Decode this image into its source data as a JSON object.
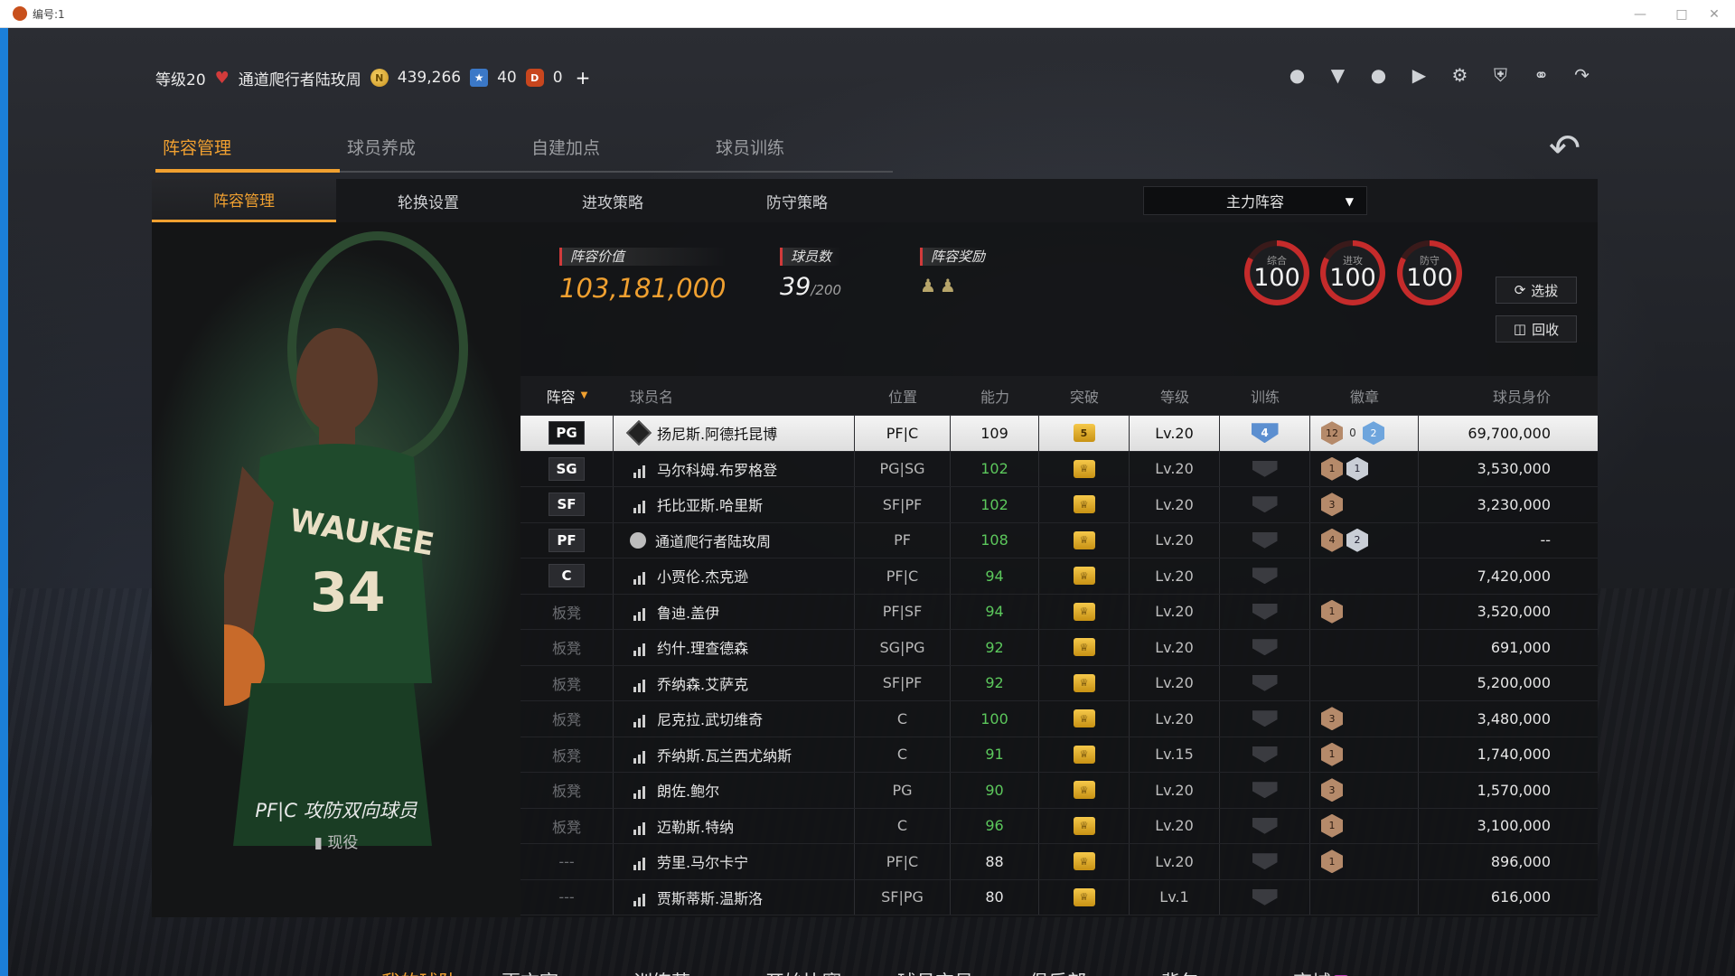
{
  "window": {
    "title": "编号:1"
  },
  "status": {
    "level": "等级20",
    "player_name": "通道爬行者陆玫周",
    "coins": "439,266",
    "stars": "40",
    "gems": "0"
  },
  "main_tabs": [
    "阵容管理",
    "球员养成",
    "自建加点",
    "球员训练"
  ],
  "sub_tabs": [
    "阵容管理",
    "轮换设置",
    "进攻策略",
    "防守策略"
  ],
  "lineup_dropdown": "主力阵容",
  "stats": {
    "value_label": "阵容价值",
    "value": "103,181,000",
    "count_label": "球员数",
    "count": "39",
    "count_max": "/200",
    "reward_label": "阵容奖励"
  },
  "gauges": [
    {
      "label": "综合",
      "value": "100"
    },
    {
      "label": "进攻",
      "value": "100"
    },
    {
      "label": "防守",
      "value": "100"
    }
  ],
  "buttons": {
    "draft": "选拔",
    "recycle": "回收"
  },
  "player_card": {
    "role": "PF|C 攻防双向球员",
    "status": "现役"
  },
  "table": {
    "headers": {
      "slot": "阵容",
      "name": "球员名",
      "pos": "位置",
      "ovr": "能力",
      "breakthrough": "突破",
      "level": "等级",
      "training": "训练",
      "badges": "徽章",
      "value": "球员身价"
    },
    "rows": [
      {
        "slot": "PG",
        "name": "扬尼斯.阿德托昆博",
        "pos": "PF|C",
        "ovr": "109",
        "brk": "5",
        "lvl": "Lv.20",
        "trn": "4",
        "badges": [
          "12",
          "0",
          "2"
        ],
        "val": "69,700,000"
      },
      {
        "slot": "SG",
        "name": "马尔科姆.布罗格登",
        "pos": "PG|SG",
        "ovr": "102",
        "brk": "",
        "lvl": "Lv.20",
        "trn": "",
        "badges": [
          "1",
          "1"
        ],
        "val": "3,530,000"
      },
      {
        "slot": "SF",
        "name": "托比亚斯.哈里斯",
        "pos": "SF|PF",
        "ovr": "102",
        "brk": "",
        "lvl": "Lv.20",
        "trn": "",
        "badges": [
          "3"
        ],
        "val": "3,230,000"
      },
      {
        "slot": "PF",
        "name": "通道爬行者陆玫周",
        "pos": "PF",
        "ovr": "108",
        "brk": "",
        "lvl": "Lv.20",
        "trn": "",
        "badges": [
          "4",
          "2"
        ],
        "val": "--"
      },
      {
        "slot": "C",
        "name": "小贾伦.杰克逊",
        "pos": "PF|C",
        "ovr": "94",
        "brk": "",
        "lvl": "Lv.20",
        "trn": "",
        "badges": [],
        "val": "7,420,000"
      },
      {
        "slot": "板凳",
        "name": "鲁迪.盖伊",
        "pos": "PF|SF",
        "ovr": "94",
        "brk": "",
        "lvl": "Lv.20",
        "trn": "",
        "badges": [
          "1"
        ],
        "val": "3,520,000"
      },
      {
        "slot": "板凳",
        "name": "约什.理查德森",
        "pos": "SG|PG",
        "ovr": "92",
        "brk": "",
        "lvl": "Lv.20",
        "trn": "",
        "badges": [],
        "val": "691,000"
      },
      {
        "slot": "板凳",
        "name": "乔纳森.艾萨克",
        "pos": "SF|PF",
        "ovr": "92",
        "brk": "",
        "lvl": "Lv.20",
        "trn": "",
        "badges": [],
        "val": "5,200,000"
      },
      {
        "slot": "板凳",
        "name": "尼克拉.武切维奇",
        "pos": "C",
        "ovr": "100",
        "brk": "",
        "lvl": "Lv.20",
        "trn": "",
        "badges": [
          "3"
        ],
        "val": "3,480,000"
      },
      {
        "slot": "板凳",
        "name": "乔纳斯.瓦兰西尤纳斯",
        "pos": "C",
        "ovr": "91",
        "brk": "",
        "lvl": "Lv.15",
        "trn": "",
        "badges": [
          "1"
        ],
        "val": "1,740,000"
      },
      {
        "slot": "板凳",
        "name": "朗佐.鲍尔",
        "pos": "PG",
        "ovr": "90",
        "brk": "",
        "lvl": "Lv.20",
        "trn": "",
        "badges": [
          "3"
        ],
        "val": "1,570,000"
      },
      {
        "slot": "板凳",
        "name": "迈勒斯.特纳",
        "pos": "C",
        "ovr": "96",
        "brk": "",
        "lvl": "Lv.20",
        "trn": "",
        "badges": [
          "1"
        ],
        "val": "3,100,000"
      },
      {
        "slot": "---",
        "name": "劳里.马尔卡宁",
        "pos": "PF|C",
        "ovr": "88",
        "brk": "",
        "lvl": "Lv.20",
        "trn": "",
        "badges": [
          "1"
        ],
        "val": "896,000"
      },
      {
        "slot": "---",
        "name": "贾斯蒂斯.温斯洛",
        "pos": "SF|PG",
        "ovr": "80",
        "brk": "",
        "lvl": "Lv.1",
        "trn": "",
        "badges": [],
        "val": "616,000"
      }
    ]
  },
  "bottom_nav": [
    "我的球队",
    "更衣室",
    "训练营",
    "开始比赛",
    "球员交易",
    "俱乐部",
    "背包",
    "商城"
  ],
  "colors": {
    "accent": "#f0a030",
    "green": "#5cc85c",
    "red": "#d23b3b"
  }
}
